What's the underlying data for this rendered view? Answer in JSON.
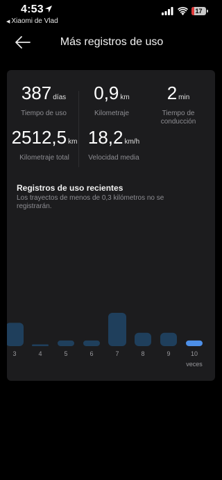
{
  "status_bar": {
    "time": "4:53",
    "back_app": "Xiaomi de Vlad",
    "battery_level": "17",
    "battery_color": "#e03a3a"
  },
  "nav": {
    "back_icon": "arrow-left-icon",
    "title": "Más registros de uso"
  },
  "stats": {
    "days": {
      "value": "387",
      "unit": "días",
      "label": "Tiempo de uso"
    },
    "mileage": {
      "value": "0,9",
      "unit": "km",
      "label": "Kilometraje"
    },
    "drive_time": {
      "value": "2",
      "unit": "min",
      "label": "Tiempo de conducción"
    },
    "total_mileage": {
      "value": "2512,5",
      "unit": "km",
      "label": "Kilometraje total"
    },
    "avg_speed": {
      "value": "18,2",
      "unit": "km/h",
      "label": "Velocidad media"
    }
  },
  "recent": {
    "title": "Registros de uso recientes",
    "description": "Los trayectos de menos de 0,3 kilómetros no se registrarán."
  },
  "chart_data": {
    "type": "bar",
    "categories": [
      "3",
      "4",
      "5",
      "6",
      "7",
      "8",
      "9",
      "10"
    ],
    "values": [
      0.7,
      0.04,
      0.17,
      0.17,
      1.0,
      0.4,
      0.4,
      0.17
    ],
    "highlight_index": 7,
    "unit_label": "veces",
    "colors": {
      "bar": "#1f3f5c",
      "highlight": "#4d8fe8",
      "tick": "#9a9a9e"
    }
  }
}
